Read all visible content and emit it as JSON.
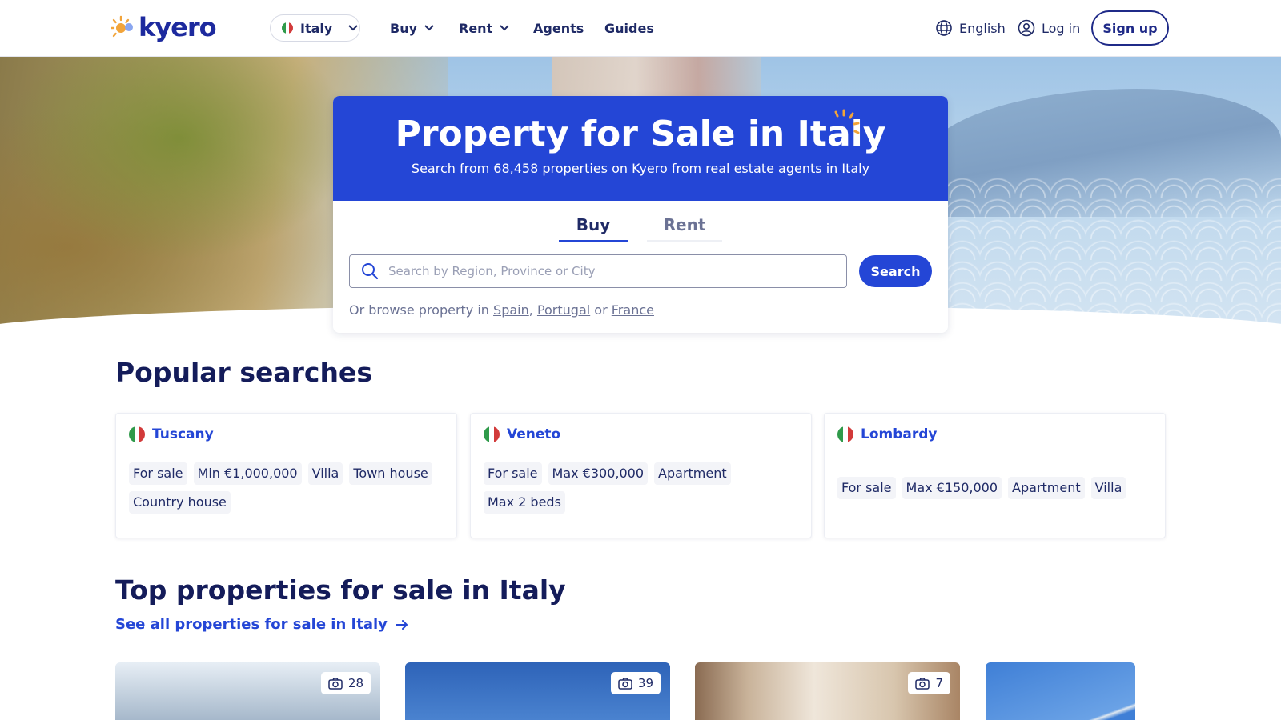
{
  "header": {
    "logo_text": "kyero",
    "country": "Italy",
    "nav": [
      {
        "label": "Buy",
        "has_dropdown": true
      },
      {
        "label": "Rent",
        "has_dropdown": true
      },
      {
        "label": "Agents",
        "has_dropdown": false
      },
      {
        "label": "Guides",
        "has_dropdown": false
      }
    ],
    "language": "English",
    "login": "Log in",
    "signup": "Sign up"
  },
  "hero": {
    "title": "Property for Sale in Italy",
    "subtitle": "Search from 68,458 properties on Kyero from real estate agents in Italy",
    "tabs": [
      "Buy",
      "Rent"
    ],
    "active_tab": "Buy",
    "search": {
      "placeholder": "Search by Region, Province or City",
      "value": "",
      "button": "Search"
    },
    "browse": {
      "prefix": "Or browse property in",
      "links": [
        "Spain",
        "Portugal",
        "France"
      ],
      "sep": ",",
      "or": "or"
    }
  },
  "popular": {
    "heading": "Popular searches",
    "cards": [
      {
        "region": "Tuscany",
        "chips": [
          "For sale",
          "Min €1,000,000",
          "Villa",
          "Town house",
          "Country house"
        ]
      },
      {
        "region": "Veneto",
        "chips": [
          "For sale",
          "Max €300,000",
          "Apartment",
          "Max 2 beds"
        ]
      },
      {
        "region": "Lombardy",
        "chips": [
          "For sale",
          "Max €150,000",
          "Apartment",
          "Villa"
        ]
      }
    ]
  },
  "top": {
    "heading": "Top properties for sale in Italy",
    "see_all": "See all properties for sale in Italy",
    "properties": [
      {
        "photo_count": "28"
      },
      {
        "photo_count": "39"
      },
      {
        "photo_count": "7"
      },
      {
        "photo_count": ""
      }
    ]
  },
  "colors": {
    "brand_blue": "#2446d6",
    "navy": "#1f2a66",
    "flag_green": "#2f9a4a",
    "flag_red": "#d23a3a",
    "accent_orange": "#f2a43a"
  }
}
